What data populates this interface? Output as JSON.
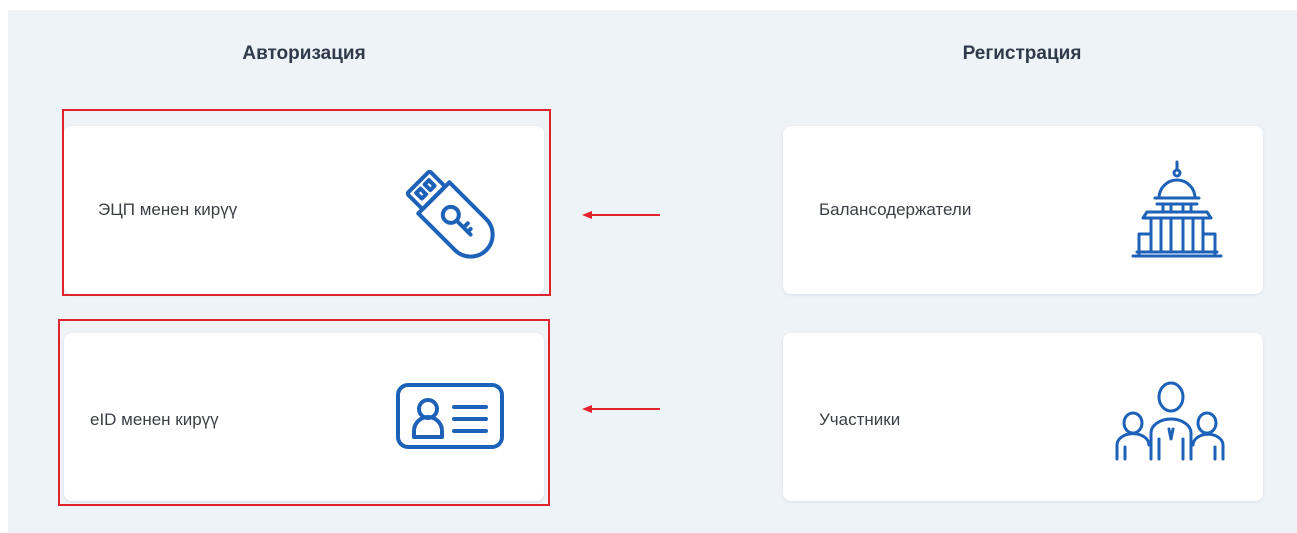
{
  "auth": {
    "heading": "Авторизация",
    "cards": [
      {
        "label": "ЭЦП менен кирүү",
        "icon": "usb-key-icon"
      },
      {
        "label": "eID менен кирүү",
        "icon": "id-card-icon"
      }
    ]
  },
  "registration": {
    "heading": "Регистрация",
    "cards": [
      {
        "label": "Балансодержатели",
        "icon": "capitol-building-icon"
      },
      {
        "label": "Участники",
        "icon": "people-group-icon"
      }
    ]
  },
  "colors": {
    "background_panel": "#eef3f8",
    "icon_blue": "#1d62b8",
    "highlight_red": "#e0222a",
    "text": "#3b3f45"
  }
}
